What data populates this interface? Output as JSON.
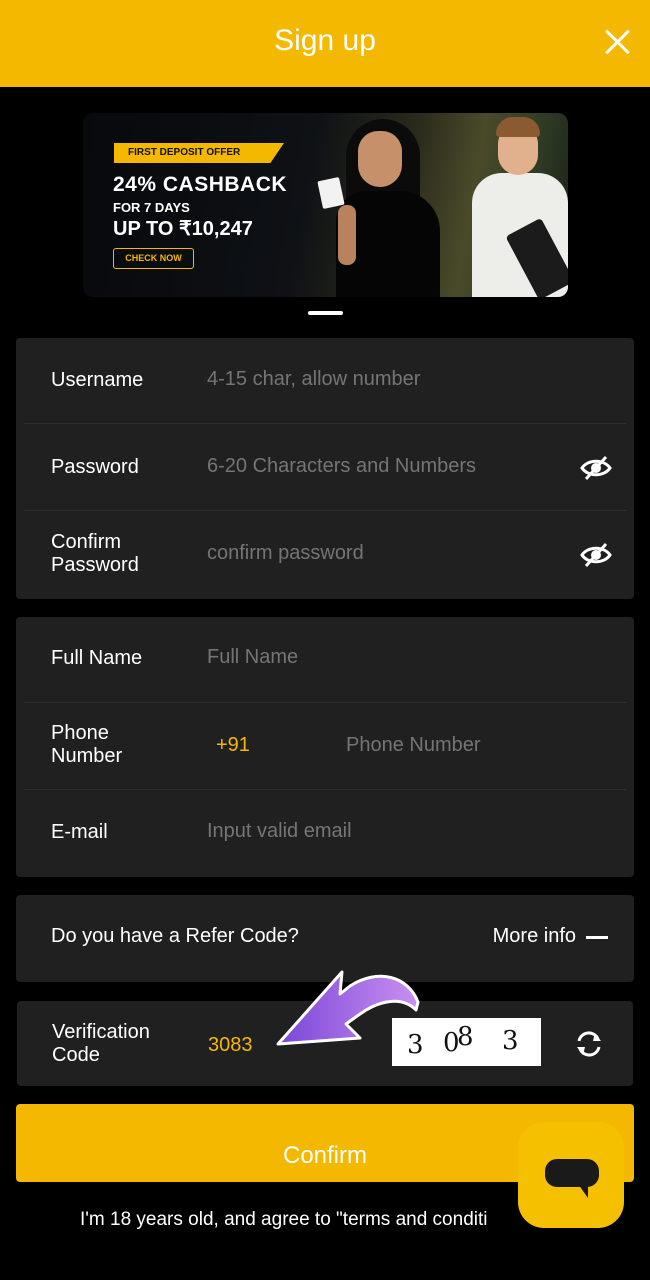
{
  "header": {
    "title": "Sign up",
    "close_icon": "close-icon"
  },
  "banner": {
    "offer_tag": "FIRST DEPOSIT OFFER",
    "headline": "24% CASHBACK",
    "subline": "FOR 7 DAYS",
    "amount": "UP TO ₹10,247",
    "cta": "CHECK NOW"
  },
  "account": {
    "username": {
      "label": "Username",
      "placeholder": "4-15 char, allow number"
    },
    "password": {
      "label": "Password",
      "placeholder": "6-20 Characters and Numbers",
      "icon": "eye-slash-icon"
    },
    "confirm_password": {
      "label_line1": "Confirm",
      "label_line2": "Password",
      "placeholder": "confirm password",
      "icon": "eye-slash-icon"
    }
  },
  "profile": {
    "full_name": {
      "label": "Full Name",
      "placeholder": "Full Name"
    },
    "phone": {
      "label_line1": "Phone",
      "label_line2": "Number",
      "country_code": "+91",
      "placeholder": "Phone Number"
    },
    "email": {
      "label": "E-mail",
      "placeholder": "Input valid email"
    }
  },
  "refer": {
    "question": "Do you have a Refer Code?",
    "more_info": "More info"
  },
  "verification": {
    "label_line1": "Verification",
    "label_line2": "Code",
    "code": "3083",
    "captcha_digits": [
      "3",
      "0",
      "8",
      "3"
    ],
    "refresh_icon": "refresh-icon"
  },
  "confirm_button": "Confirm",
  "agree_text": "I'm 18 years old, and agree to \"terms and conditi",
  "colors": {
    "accent": "#f5b800",
    "card": "#202020",
    "background": "#000000"
  }
}
